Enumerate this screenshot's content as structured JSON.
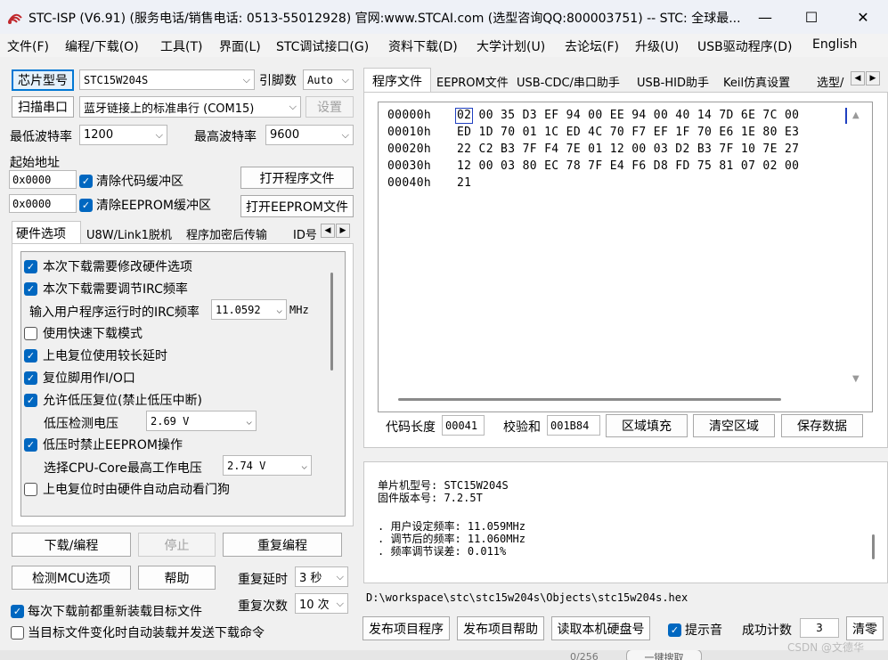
{
  "window": {
    "title": "STC-ISP (V6.91) (服务电话/销售电话: 0513-55012928) 官网:www.STCAI.com  (选型咨询QQ:800003751) -- STC: 全球最..."
  },
  "menu": [
    "文件(F)",
    "编程/下载(O)",
    "工具(T)",
    "界面(L)",
    "STC调试接口(G)",
    "资料下载(D)",
    "大学计划(U)",
    "去论坛(F)",
    "升级(U)",
    "USB驱动程序(D)",
    "English"
  ],
  "left": {
    "chip_button": "芯片型号",
    "chip_value": "STC15W204S",
    "pin_label": "引脚数",
    "pin_value": "Auto",
    "scan_button": "扫描串口",
    "port_value": "蓝牙链接上的标准串行 (COM15)",
    "settings_button": "设置",
    "min_baud_label": "最低波特率",
    "min_baud_value": "1200",
    "max_baud_label": "最高波特率",
    "max_baud_value": "9600",
    "start_addr_label": "起始地址",
    "addr1": "0x0000",
    "clear_code": "清除代码缓冲区",
    "open_prog": "打开程序文件",
    "addr2": "0x0000",
    "clear_eeprom": "清除EEPROM缓冲区",
    "open_eeprom": "打开EEPROM文件",
    "hw_tabs": [
      "硬件选项",
      "U8W/Link1脱机",
      "程序加密后传输",
      "ID号"
    ],
    "options": {
      "opt1": "本次下载需要修改硬件选项",
      "opt2": "本次下载需要调节IRC频率",
      "irc_label": "输入用户程序运行时的IRC频率",
      "irc_value": "11.0592",
      "irc_unit": "MHz",
      "opt3": "使用快速下载模式",
      "opt4": "上电复位使用较长延时",
      "opt5": "复位脚用作I/O口",
      "opt6": "允许低压复位(禁止低压中断)",
      "lv_label": "低压检测电压",
      "lv_value": "2.69 V",
      "opt7": "低压时禁止EEPROM操作",
      "cpu_label": "选择CPU-Core最高工作电压",
      "cpu_value": "2.74 V",
      "opt8": "上电复位时由硬件自动启动看门狗"
    },
    "download_button": "下载/编程",
    "stop_button": "停止",
    "reprogram_button": "重复编程",
    "detect_button": "检测MCU选项",
    "help_button": "帮助",
    "repeat_delay_label": "重复延时",
    "repeat_delay_value": "3 秒",
    "repeat_count_label": "重复次数",
    "repeat_count_value": "10 次",
    "reload_each": "每次下载前都重新装载目标文件",
    "auto_send": "当目标文件变化时自动装载并发送下载命令"
  },
  "right": {
    "tabs": [
      "程序文件",
      "EEPROM文件",
      "USB-CDC/串口助手",
      "USB-HID助手",
      "Keil仿真设置",
      "选型/"
    ],
    "hex": [
      {
        "addr": "00000h",
        "bytes": "02 00 35 D3 EF 94 00 EE 94 00 40 14 7D 6E 7C 00"
      },
      {
        "addr": "00010h",
        "bytes": "ED 1D 70 01 1C ED 4C 70 F7 EF 1F 70 E6 1E 80 E3"
      },
      {
        "addr": "00020h",
        "bytes": "22 C2 B3 7F F4 7E 01 12 00 03 D2 B3 7F 10 7E 27"
      },
      {
        "addr": "00030h",
        "bytes": "12 00 03 80 EC 78 7F E4 F6 D8 FD 75 81 07 02 00"
      },
      {
        "addr": "00040h",
        "bytes": "21"
      }
    ],
    "code_len_label": "代码长度",
    "code_len_value": "00041",
    "checksum_label": "校验和",
    "checksum_value": "001B84",
    "fill_button": "区域填充",
    "clear_button": "清空区域",
    "save_button": "保存数据",
    "info": {
      "line1": "单片机型号: STC15W204S",
      "line2": "固件版本号: 7.2.5T",
      "line3": ". 用户设定频率: 11.059MHz",
      "line4": ". 调节后的频率: 11.060MHz",
      "line5": ". 频率调节误差: 0.011%"
    },
    "path": "D:\\workspace\\stc\\stc15w204s\\Objects\\stc15w204s.hex",
    "publish_prog": "发布项目程序",
    "publish_help": "发布项目帮助",
    "read_disk": "读取本机硬盘号",
    "tip_sound": "提示音",
    "success_label": "成功计数",
    "success_value": "3",
    "clear_count": "清零"
  },
  "bottom": {
    "counter": "0/256",
    "one_key": "一键搜取",
    "watermark": "CSDN @文德华"
  }
}
